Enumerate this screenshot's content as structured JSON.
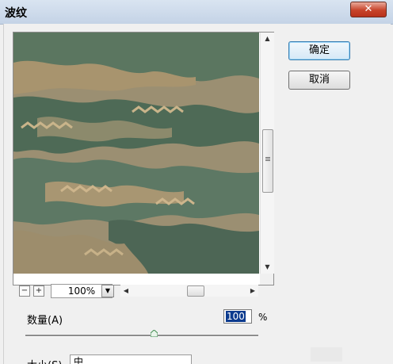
{
  "window": {
    "title": "波纹",
    "close_label": "✕"
  },
  "buttons": {
    "ok": "确定",
    "cancel": "取消"
  },
  "zoom": {
    "minus": "−",
    "plus": "+",
    "value": "100%"
  },
  "amount": {
    "label": "数量(A)",
    "value": "100",
    "unit": "%"
  },
  "size": {
    "label": "大小(S)",
    "value": "中"
  },
  "colors": {
    "title_text": "#000000",
    "close_red": "#c7432a",
    "selection": "#0b3a8e"
  }
}
